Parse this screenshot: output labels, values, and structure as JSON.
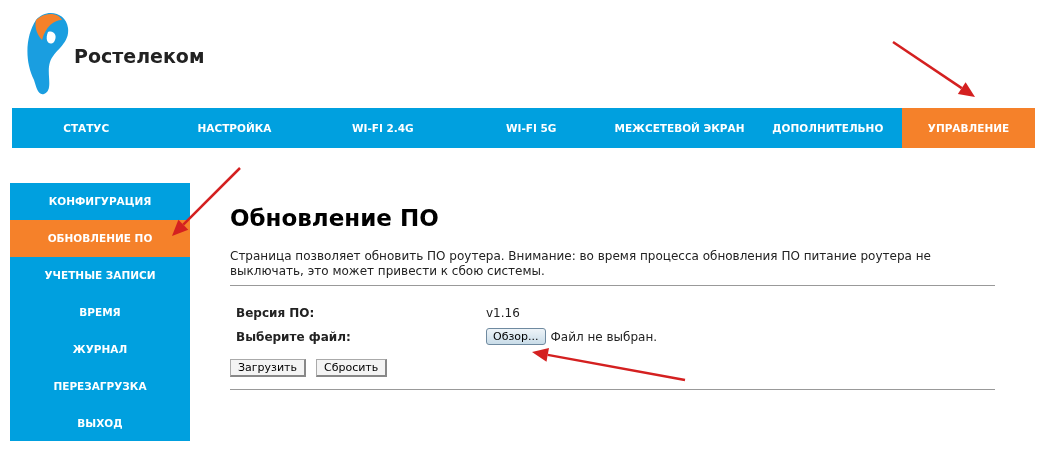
{
  "brand": {
    "name": "Ростелеком"
  },
  "top_nav": [
    {
      "label": "СТАТУС",
      "selected": false
    },
    {
      "label": "НАСТРОЙКА",
      "selected": false
    },
    {
      "label": "WI-FI 2.4G",
      "selected": false
    },
    {
      "label": "WI-FI 5G",
      "selected": false
    },
    {
      "label": "МЕЖСЕТЕВОЙ ЭКРАН",
      "selected": false
    },
    {
      "label": "ДОПОЛНИТЕЛЬНО",
      "selected": false
    },
    {
      "label": "УПРАВЛЕНИЕ",
      "selected": true
    }
  ],
  "sidebar": {
    "items": [
      {
        "label": "КОНФИГУРАЦИЯ",
        "selected": false
      },
      {
        "label": "ОБНОВЛЕНИЕ ПО",
        "selected": true
      },
      {
        "label": "УЧЕТНЫЕ ЗАПИСИ",
        "selected": false
      },
      {
        "label": "ВРЕМЯ",
        "selected": false
      },
      {
        "label": "ЖУРНАЛ",
        "selected": false
      },
      {
        "label": "ПЕРЕЗАГРУЗКА",
        "selected": false
      },
      {
        "label": "ВЫХОД",
        "selected": false
      }
    ]
  },
  "content": {
    "title": "Обновление ПО",
    "description": "Страница позволяет обновить ПО роутера. Внимание: во время процесса обновления ПО питание роутера не выключать, это может привести к сбою системы.",
    "firmware_version": {
      "label": "Версия ПО:",
      "value": "v1.16"
    },
    "file_select": {
      "label": "Выберите файл:",
      "button": "Обзор...",
      "status": "Файл не выбран."
    },
    "buttons": [
      "Загрузить",
      "Сбросить"
    ]
  }
}
